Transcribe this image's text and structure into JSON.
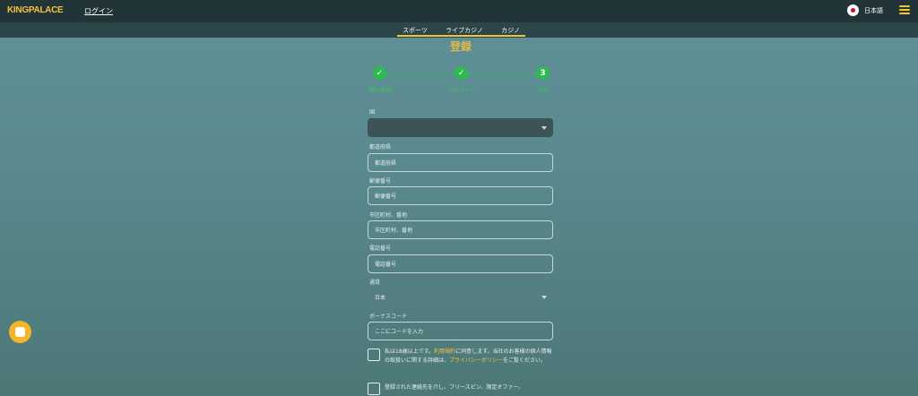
{
  "header": {
    "logo_part1": "KING",
    "logo_part2": "PALACE",
    "login_label": "ログイン",
    "language_label": "日本語",
    "flag_icon": "japan-flag-icon",
    "menu_icon": "hamburger-menu-icon"
  },
  "subnav": {
    "tabs": [
      {
        "label": "スポーツ"
      },
      {
        "label": "ライブカジノ"
      },
      {
        "label": "カジノ"
      }
    ]
  },
  "registration": {
    "title": "登録",
    "steps": [
      {
        "state": "done",
        "label": "個人情報"
      },
      {
        "state": "done",
        "label": "アカウント"
      },
      {
        "state": "current",
        "number": "3",
        "label": "住所"
      }
    ]
  },
  "form": {
    "country": {
      "label": "国",
      "value": ""
    },
    "prefecture": {
      "label": "都道府県",
      "placeholder": "都道府県"
    },
    "postal_code": {
      "label": "郵便番号",
      "placeholder": "郵便番号"
    },
    "city_address": {
      "label": "市区町村、番地",
      "placeholder": "市区町村、番地"
    },
    "phone": {
      "label": "電話番号",
      "placeholder": "電話番号"
    },
    "currency": {
      "label": "通貨",
      "value": "日本"
    },
    "bonus_code": {
      "label": "ボーナスコード",
      "placeholder": "ここにコードを入力"
    },
    "terms_checkbox": {
      "text_before": "私は18歳以上です。",
      "link_terms": "利用規約",
      "text_middle": "に同意します。当社のお客様の個人情報の取扱いに関する詳細は、",
      "link_privacy": "プライバシーポリシー",
      "text_after": "をご覧ください。"
    },
    "promo_checkbox": {
      "text": "登録された連絡先を介し、フリースピン、限定オファー、"
    }
  },
  "chat": {
    "icon": "chat-bubble-icon"
  },
  "colors": {
    "accent": "#f5c23c",
    "success": "#2fbb4f",
    "topbar": "#213437"
  }
}
